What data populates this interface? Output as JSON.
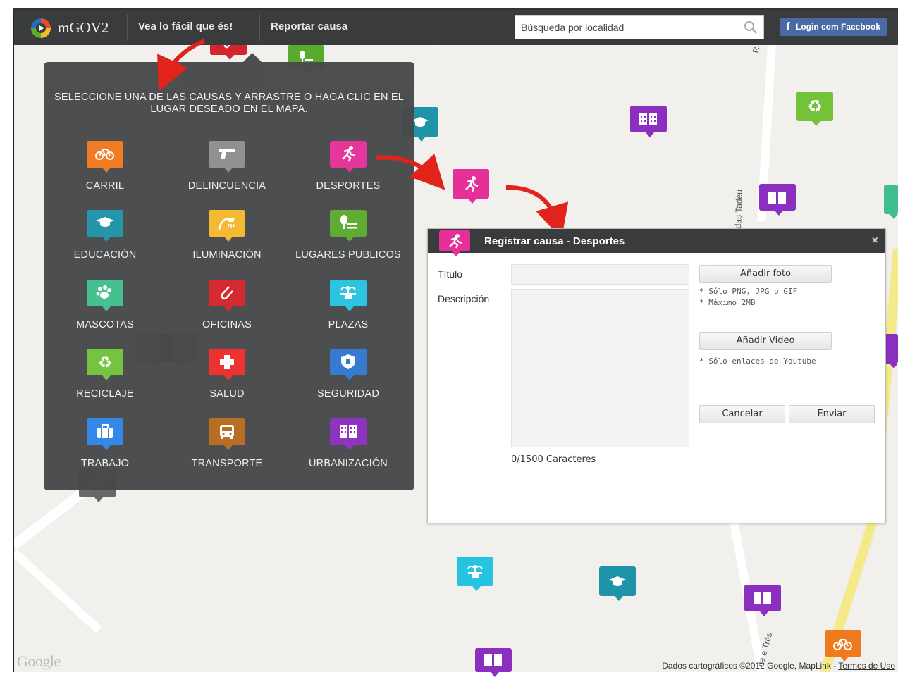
{
  "header": {
    "logo_text": "mGOV2",
    "nav": [
      "Vea lo fácil que és!",
      "Reportar causa"
    ],
    "search_placeholder": "Búsqueda por localidad",
    "login_label": "Login com Facebook"
  },
  "panel": {
    "instruction": "SELECCIONE UNA DE LAS CAUSAS Y ARRASTRE O HAGA CLIC EN EL LUGAR DESEADO EN EL MAPA.",
    "causes": [
      {
        "label": "CARRIL",
        "icon": "bicycle-icon",
        "color": "#f07a1e"
      },
      {
        "label": "DELINCUENCIA",
        "icon": "gun-icon",
        "color": "#8e8e8e"
      },
      {
        "label": "DESPORTES",
        "icon": "runner-icon",
        "color": "#e5309a"
      },
      {
        "label": "EDUCACIÓN",
        "icon": "graduation-cap-icon",
        "color": "#1f93a8"
      },
      {
        "label": "ILUMINACIÓN",
        "icon": "streetlight-icon",
        "color": "#f5b92d"
      },
      {
        "label": "LUGARES PUBLICOS",
        "icon": "park-bench-icon",
        "color": "#5aaa2e"
      },
      {
        "label": "MASCOTAS",
        "icon": "paw-icon",
        "color": "#3fbf8f"
      },
      {
        "label": "OFICINAS",
        "icon": "paperclip-icon",
        "color": "#d6242c"
      },
      {
        "label": "PLAZAS",
        "icon": "fountain-icon",
        "color": "#26c4e0"
      },
      {
        "label": "RECICLAJE",
        "icon": "recycle-icon",
        "color": "#73c23a"
      },
      {
        "label": "SALUD",
        "icon": "health-cross-icon",
        "color": "#ee2b2b"
      },
      {
        "label": "SEGURIDAD",
        "icon": "shield-icon",
        "color": "#2f78d2"
      },
      {
        "label": "TRABAJO",
        "icon": "briefcase-icon",
        "color": "#2e86e8"
      },
      {
        "label": "TRANSPORTE",
        "icon": "bus-icon",
        "color": "#b86a1e"
      },
      {
        "label": "URBANIZACIÓN",
        "icon": "buildings-icon",
        "color": "#8a2fc0"
      }
    ]
  },
  "dialog": {
    "title": "Registrar causa - Desportes",
    "close": "×",
    "title_label": "Título",
    "description_label": "Descripción",
    "add_photo": "Añadir foto",
    "photo_notes": [
      "* Sólo PNG, JPG o GIF",
      "* Máximo 2MB"
    ],
    "add_video": "Añadir Video",
    "video_note": "* Sólo enlaces de Youtube",
    "cancel": "Cancelar",
    "send": "Enviar",
    "char_count": "0/1500 Caracteres"
  },
  "map": {
    "streets": [
      "R. São Judas T",
      "das Tadeu",
      "ita e Três"
    ],
    "google_logo": "Google",
    "attribution": "Dados cartográficos ©2012 Google, MapLink -",
    "terms": "Termos de Uso"
  }
}
